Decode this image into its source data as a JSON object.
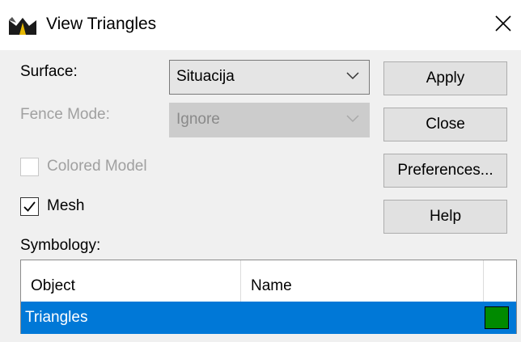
{
  "window": {
    "title": "View Triangles",
    "close_icon": "close-x-icon",
    "app_icon": "road-surface-icon"
  },
  "form": {
    "surface_label": "Surface:",
    "surface_value": "Situacija",
    "fence_mode_label": "Fence Mode:",
    "fence_mode_value": "Ignore",
    "colored_model_label": "Colored Model",
    "colored_model_checked": false,
    "mesh_label": "Mesh",
    "mesh_checked": true,
    "symbology_label": "Symbology:"
  },
  "buttons": {
    "apply": "Apply",
    "close": "Close",
    "preferences": "Preferences...",
    "help": "Help"
  },
  "symbology_table": {
    "columns": [
      "Object",
      "Name",
      ""
    ],
    "rows": [
      {
        "object": "Triangles",
        "name": "",
        "color": "#008a00"
      }
    ]
  },
  "colors": {
    "selection": "#0078d7",
    "swatch": "#008a00"
  }
}
